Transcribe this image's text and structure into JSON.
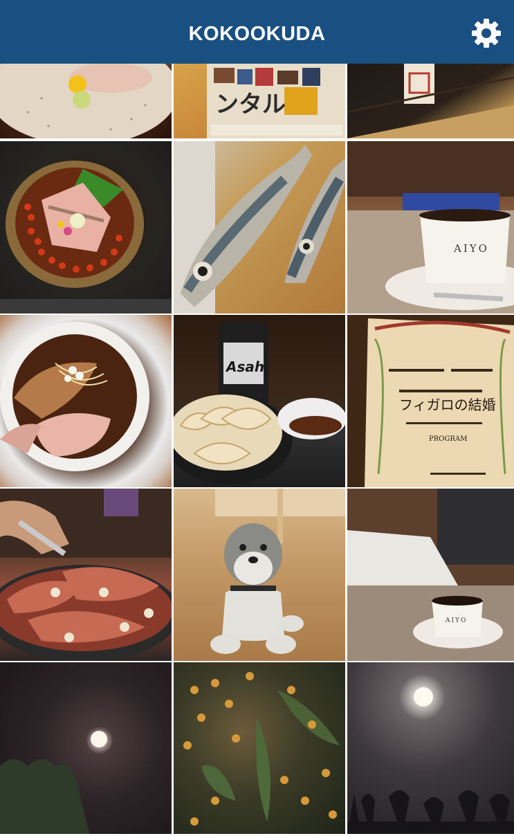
{
  "header": {
    "title": "KOKOOKUDA",
    "settings_icon": "gear-icon",
    "color": "#1a4f82"
  },
  "grid": {
    "columns": 3,
    "photos": [
      {
        "name": "photo-sushi-plate",
        "text": ""
      },
      {
        "name": "photo-magazine",
        "text": "ンタル"
      },
      {
        "name": "photo-stamp",
        "text": ""
      },
      {
        "name": "photo-seafood-bowl",
        "text": ""
      },
      {
        "name": "photo-mackerel",
        "text": ""
      },
      {
        "name": "photo-coffee-aiyo-1",
        "text": "AIYO"
      },
      {
        "name": "photo-ramen",
        "text": ""
      },
      {
        "name": "photo-gyoza",
        "text": "Asahi"
      },
      {
        "name": "photo-figaro-program",
        "text": "フィガロの結婚"
      },
      {
        "name": "photo-grill",
        "text": ""
      },
      {
        "name": "photo-schnauzer",
        "text": ""
      },
      {
        "name": "photo-coffee-aiyo-2",
        "text": "AIYO"
      },
      {
        "name": "photo-moon-1",
        "text": ""
      },
      {
        "name": "photo-osmanthus",
        "text": ""
      },
      {
        "name": "photo-moon-2",
        "text": ""
      }
    ]
  }
}
